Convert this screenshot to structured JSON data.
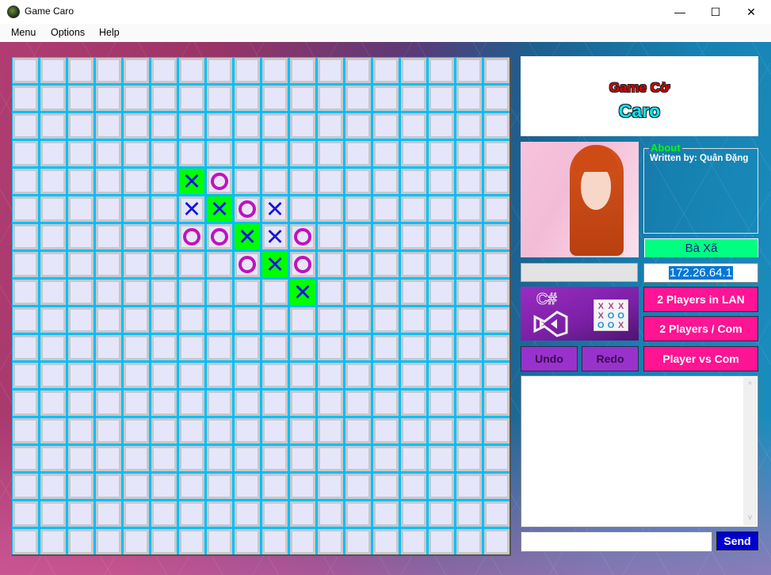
{
  "window": {
    "title": "Game Caro",
    "controls": {
      "minimize": "—",
      "maximize": "☐",
      "close": "✕"
    }
  },
  "menu": [
    {
      "label": "Menu"
    },
    {
      "label": "Options"
    },
    {
      "label": "Help"
    }
  ],
  "board": {
    "rows": 18,
    "cols": 18,
    "pieces": [
      {
        "row": 4,
        "col": 6,
        "mark": "X",
        "winning": true
      },
      {
        "row": 4,
        "col": 7,
        "mark": "O",
        "winning": false
      },
      {
        "row": 5,
        "col": 6,
        "mark": "X",
        "winning": false
      },
      {
        "row": 5,
        "col": 7,
        "mark": "X",
        "winning": true
      },
      {
        "row": 5,
        "col": 8,
        "mark": "O",
        "winning": false
      },
      {
        "row": 5,
        "col": 9,
        "mark": "X",
        "winning": false
      },
      {
        "row": 6,
        "col": 6,
        "mark": "O",
        "winning": false
      },
      {
        "row": 6,
        "col": 7,
        "mark": "O",
        "winning": false
      },
      {
        "row": 6,
        "col": 8,
        "mark": "X",
        "winning": true
      },
      {
        "row": 6,
        "col": 9,
        "mark": "X",
        "winning": false
      },
      {
        "row": 6,
        "col": 10,
        "mark": "O",
        "winning": false
      },
      {
        "row": 7,
        "col": 8,
        "mark": "O",
        "winning": false
      },
      {
        "row": 7,
        "col": 9,
        "mark": "X",
        "winning": true
      },
      {
        "row": 7,
        "col": 10,
        "mark": "O",
        "winning": false
      },
      {
        "row": 8,
        "col": 10,
        "mark": "X",
        "winning": true
      }
    ],
    "colors": {
      "grid": "#00bfff",
      "cell": "#e6e6fa",
      "win_cell": "#00ff00",
      "x": "#1a14d6",
      "o": "#c011c0"
    }
  },
  "logo": {
    "line1": "Game Cờ",
    "line2": "Caro"
  },
  "about": {
    "legend": "About",
    "text": "Written by: Quân Đặng"
  },
  "player_name": "Bà Xã",
  "ip_address": "172.26.64.1",
  "brand": {
    "cs_label": "C#",
    "ttt": [
      "X",
      "X",
      "X",
      "X",
      "O",
      "O",
      "O",
      "O",
      "X"
    ]
  },
  "buttons": {
    "lan": "2 Players in LAN",
    "two_com": "2 Players / Com",
    "vs_com": "Player vs Com",
    "undo": "Undo",
    "redo": "Redo",
    "send": "Send"
  },
  "chat": {
    "log": "",
    "input": "",
    "scroll_up": "^",
    "scroll_down": "v"
  }
}
